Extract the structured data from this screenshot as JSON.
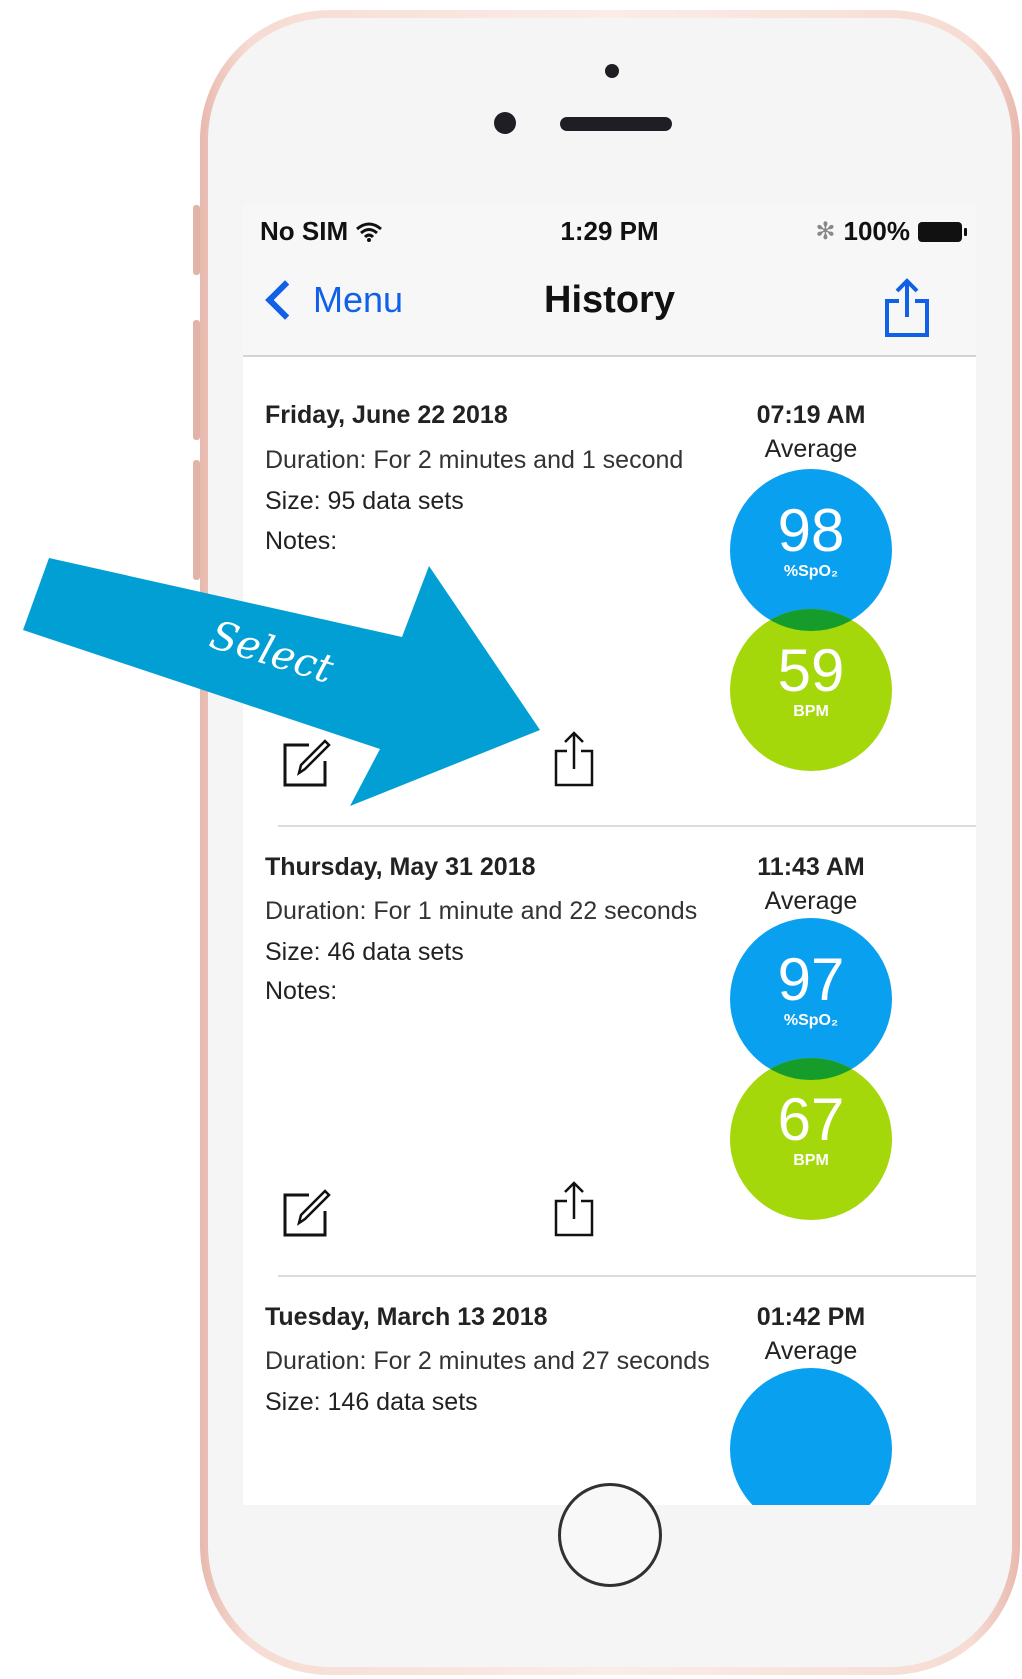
{
  "status_bar": {
    "carrier": "No SIM",
    "time": "1:29 PM",
    "battery": "100%"
  },
  "nav": {
    "back_label": "Menu",
    "title": "History"
  },
  "entries": [
    {
      "date": "Friday, June 22 2018",
      "duration": "Duration: For 2 minutes and 1 second",
      "size": "Size: 95 data sets",
      "notes": "Notes:",
      "time": "07:19 AM",
      "average_label": "Average",
      "spo2": "98",
      "spo2_unit": "%SpO₂",
      "bpm": "59",
      "bpm_unit": "BPM"
    },
    {
      "date": "Thursday, May 31 2018",
      "duration": "Duration: For 1 minute and 22 seconds",
      "size": "Size: 46 data sets",
      "notes": "Notes:",
      "time": "11:43 AM",
      "average_label": "Average",
      "spo2": "97",
      "spo2_unit": "%SpO₂",
      "bpm": "67",
      "bpm_unit": "BPM"
    },
    {
      "date": "Tuesday, March 13 2018",
      "duration": "Duration: For 2 minutes and 27 seconds",
      "size": "Size: 146 data sets",
      "time": "01:42 PM",
      "average_label": "Average"
    }
  ],
  "annotation": {
    "label": "Select",
    "color": "#019fd4"
  },
  "colors": {
    "accent": "#1160e8",
    "spo2": "#0aa0f0",
    "bpm": "#a4d80a",
    "overlap": "#169c2a"
  }
}
